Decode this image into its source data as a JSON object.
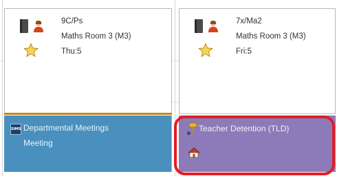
{
  "lessons": [
    {
      "class_code": "9C/Ps",
      "room": "Maths Room 3 (M3)",
      "period": "Thu:5"
    },
    {
      "class_code": "7x/Ma2",
      "room": "Maths Room 3 (M3)",
      "period": "Fri:5"
    }
  ],
  "events": {
    "meeting": {
      "badge": "SIMS",
      "line1": "Departmental Meetings",
      "line2": "Meeting",
      "color": "#4a90be"
    },
    "detention": {
      "label": "Teacher Detention (TLD)",
      "color": "#8c7bb8",
      "highlight_color": "#e51c23"
    }
  },
  "icons": {
    "book": "book-icon",
    "person": "person-icon",
    "star": "star-icon",
    "gavel": "gavel-icon",
    "house": "house-icon"
  },
  "colors": {
    "divider": "#c08a1e"
  }
}
